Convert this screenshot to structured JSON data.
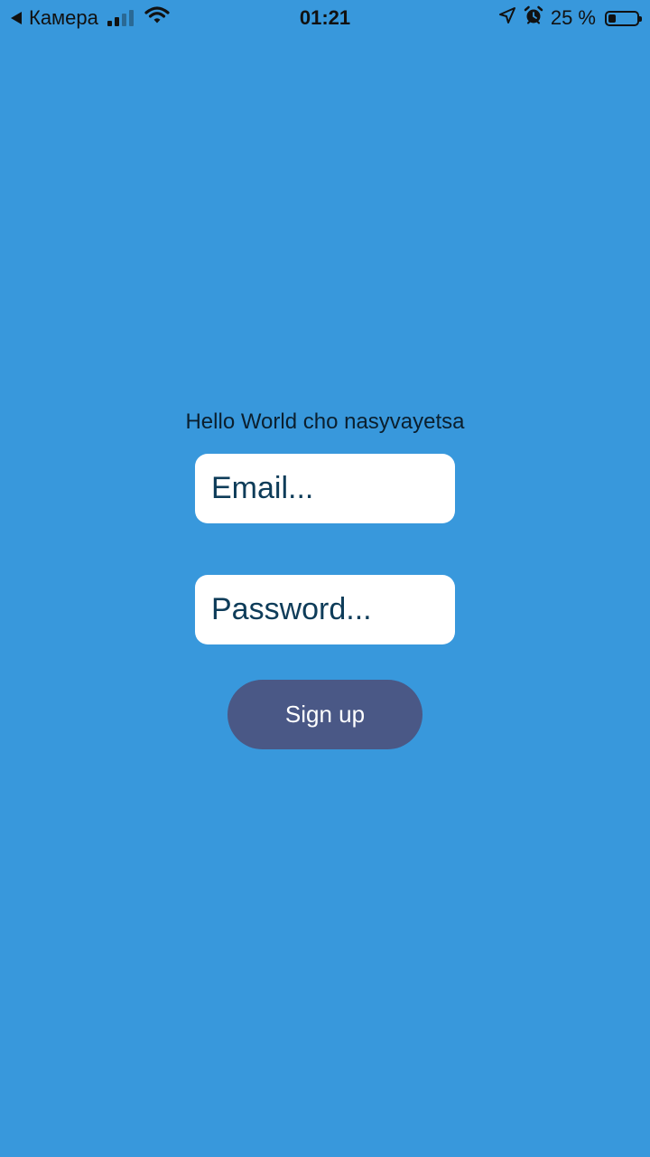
{
  "status_bar": {
    "back_app": "Камера",
    "time": "01:21",
    "battery_percent": "25 %",
    "battery_level": 0.25,
    "signal_bars_active": 2,
    "signal_bars_total": 4,
    "icons": [
      "back-arrow-icon",
      "cellular-signal-icon",
      "wifi-icon",
      "location-arrow-icon",
      "alarm-clock-icon",
      "battery-icon"
    ]
  },
  "main": {
    "greeting": "Hello World cho nasyvayetsa",
    "email_placeholder": "Email...",
    "email_value": "",
    "password_placeholder": "Password...",
    "password_value": "",
    "signup_label": "Sign up"
  },
  "colors": {
    "background": "#3898DC",
    "input_background": "#FFFFFF",
    "input_text": "#0E3C59",
    "button_background": "#4A5886",
    "button_text": "#FFFFFF"
  }
}
